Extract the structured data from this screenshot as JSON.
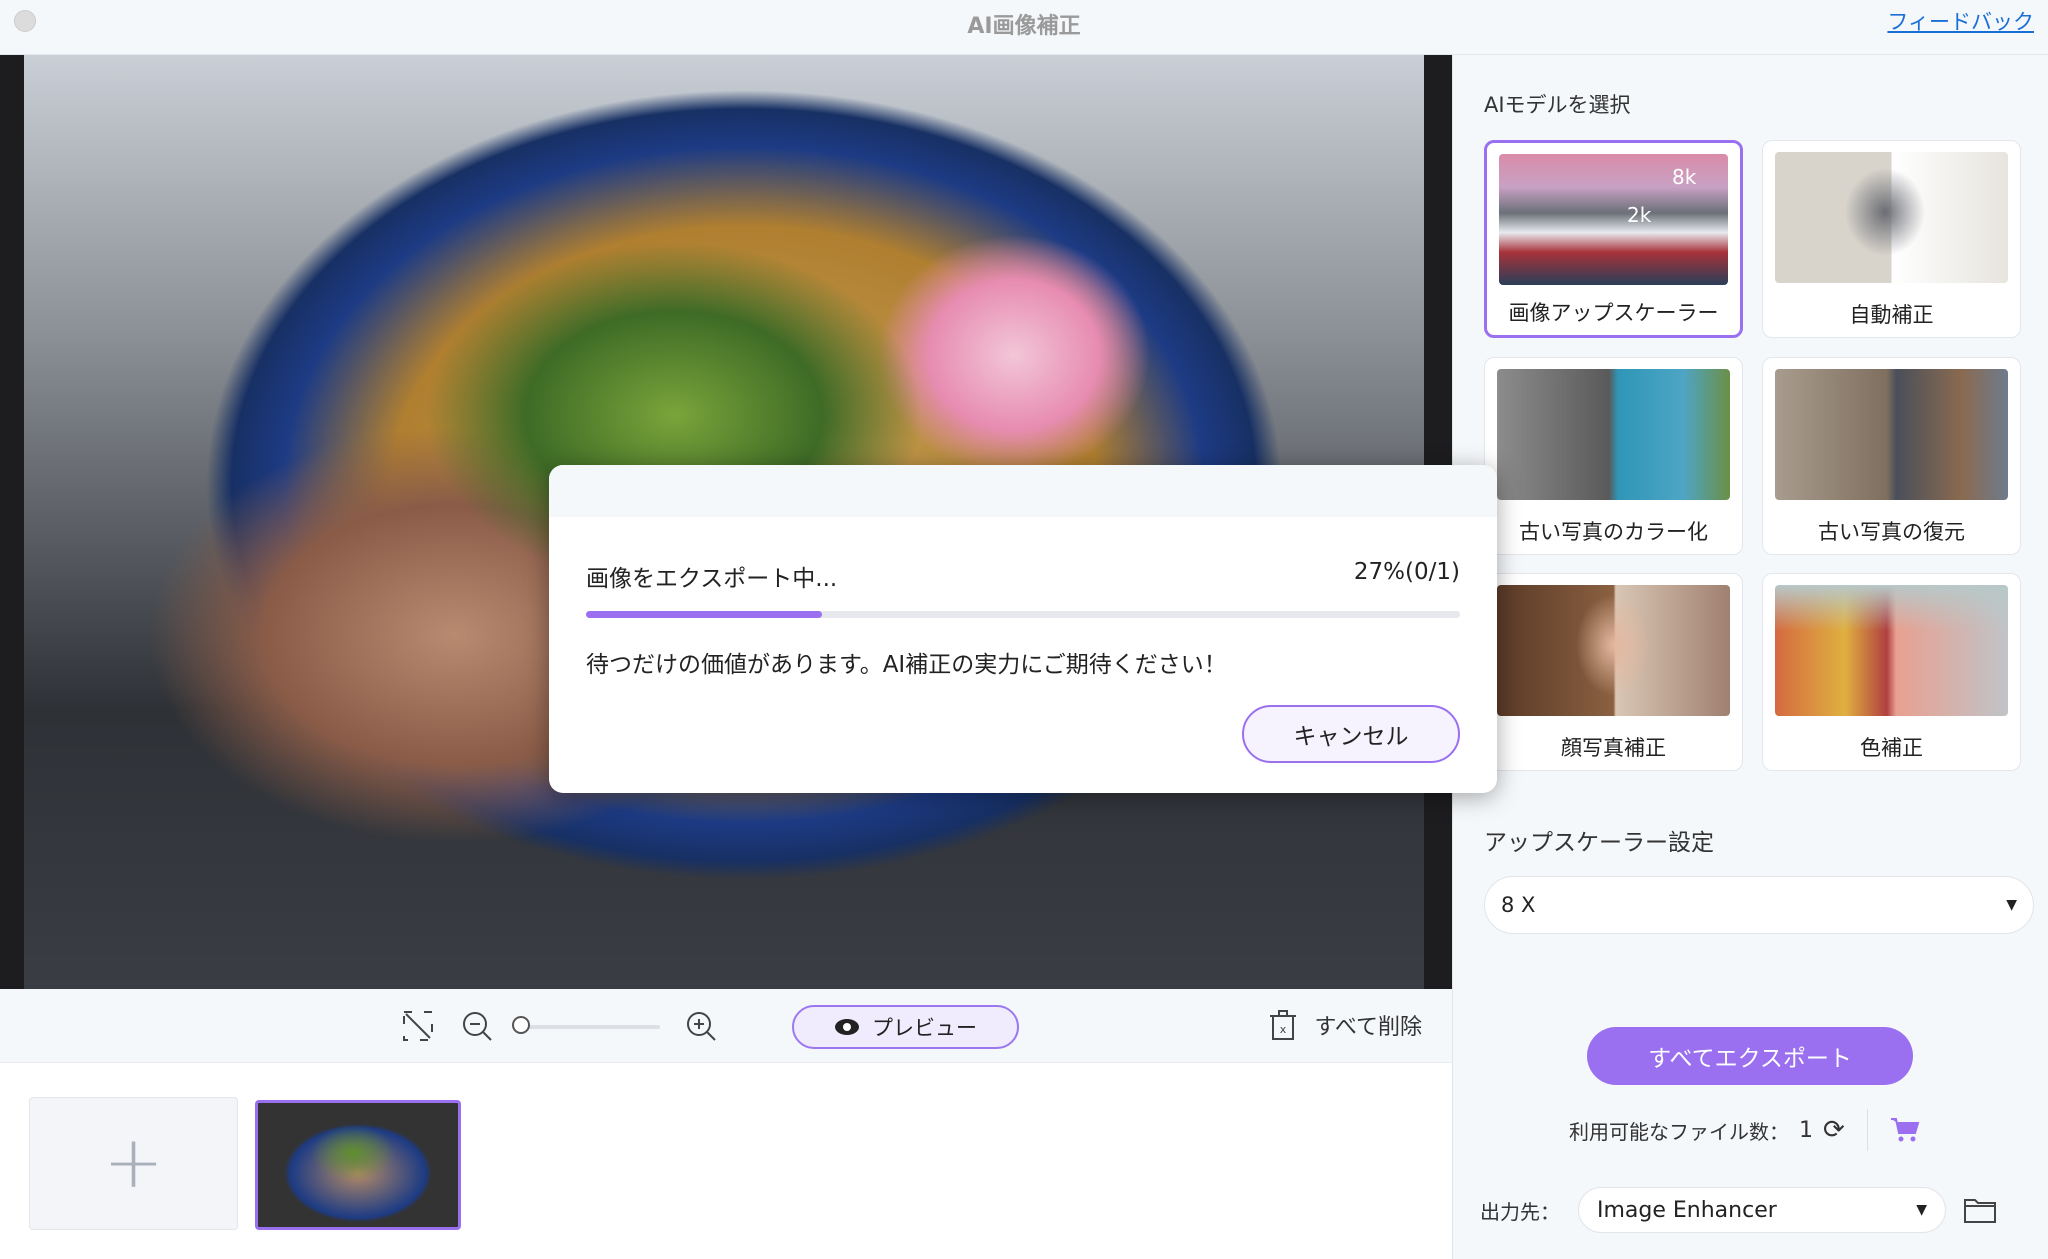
{
  "window": {
    "title": "AI画像補正",
    "feedback_link": "フィードバック"
  },
  "toolbar": {
    "fit_icon": "fit-screen-icon",
    "preview_label": "プレビュー",
    "delete_all_label": "すべて削除",
    "zoom_level": 0
  },
  "thumbnails": {
    "add_label": "+",
    "items": [
      {
        "selected": true
      }
    ]
  },
  "panel": {
    "model_heading": "AIモデルを選択",
    "models": [
      {
        "label": "画像アップスケーラー",
        "selected": true,
        "badge_a": "2k",
        "badge_b": "8k"
      },
      {
        "label": "自動補正",
        "selected": false
      },
      {
        "label": "古い写真のカラー化",
        "selected": false
      },
      {
        "label": "古い写真の復元",
        "selected": false
      },
      {
        "label": "顔写真補正",
        "selected": false
      },
      {
        "label": "色補正",
        "selected": false
      }
    ],
    "settings_heading": "アップスケーラー設定",
    "scale_value": "8 X",
    "export_all_label": "すべてエクスポート",
    "files_label": "利用可能なファイル数：",
    "files_count": "1",
    "output_label": "出力先：",
    "output_value": "Image Enhancer"
  },
  "dialog": {
    "status": "画像をエクスポート中...",
    "percent_text": "27%(0/1)",
    "progress": 0.27,
    "message": "待つだけの価値があります。AI補正の実力にご期待ください！",
    "cancel_label": "キャンセル"
  },
  "colors": {
    "accent": "#9a6ff0",
    "link": "#1a6fd6"
  }
}
